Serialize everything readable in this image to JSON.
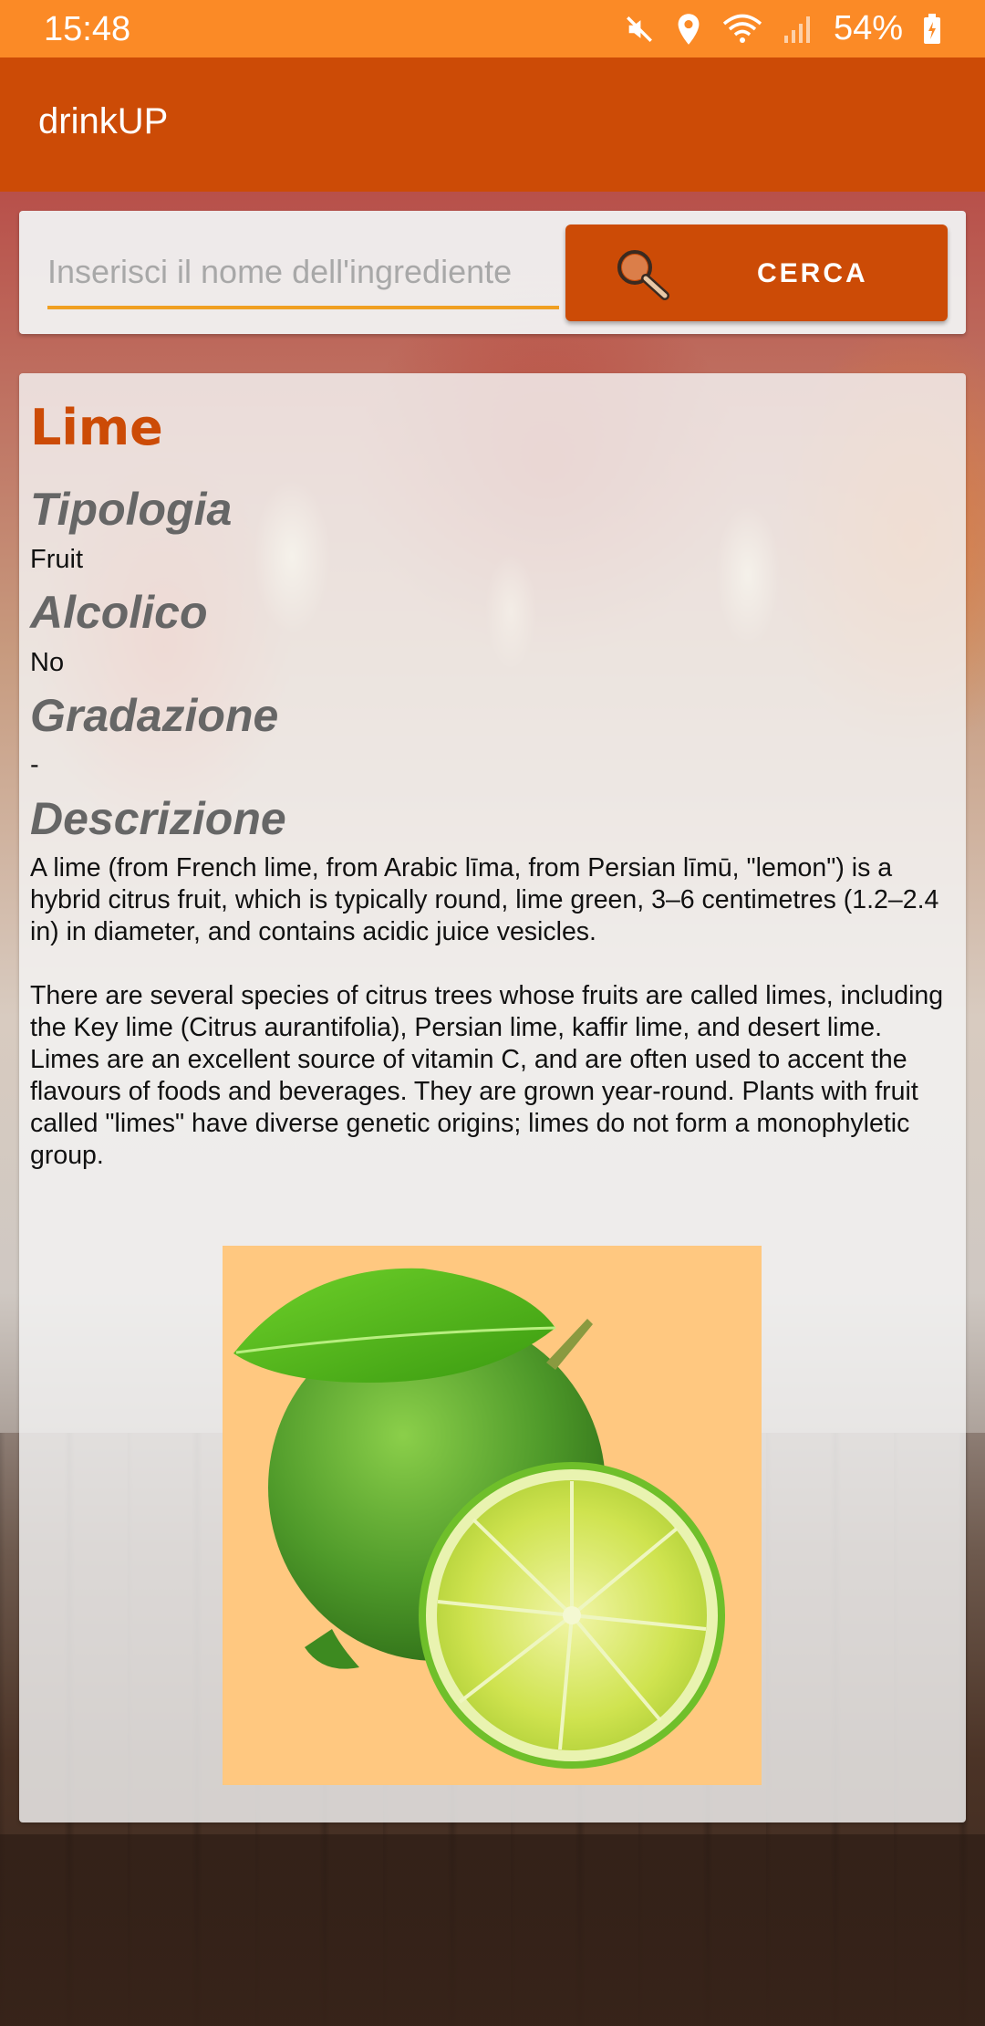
{
  "status_bar": {
    "time": "15:48",
    "battery": "54%",
    "icons": [
      "mute-icon",
      "location-icon",
      "wifi-icon",
      "signal-icon",
      "battery-icon"
    ]
  },
  "app_bar": {
    "title": "drinkUP"
  },
  "search": {
    "placeholder": "Inserisci il nome dell'ingrediente",
    "value": "",
    "button_label": "CERCA",
    "button_icon": "search-icon"
  },
  "ingredient": {
    "name": "Lime",
    "type_label": "Tipologia",
    "type_value": "Fruit",
    "alcoholic_label": "Alcolico",
    "alcoholic_value": "No",
    "abv_label": "Gradazione",
    "abv_value": "-",
    "description_label": "Descrizione",
    "description": "A lime (from French lime, from Arabic līma, from Persian līmū, \"lemon\") is a hybrid citrus fruit, which is typically round, lime green, 3–6 centimetres (1.2–2.4 in) in diameter, and contains acidic juice vesicles.\n\nThere are several species of citrus trees whose fruits are called limes, including the Key lime (Citrus aurantifolia), Persian lime, kaffir lime, and desert lime. Limes are an excellent source of vitamin C, and are often used to accent the flavours of foods and beverages. They are grown year-round. Plants with fruit called \"limes\" have diverse genetic origins; limes do not form a monophyletic group."
  },
  "colors": {
    "status_bar": "#fb8a26",
    "app_bar": "#cc4b06",
    "accent": "#cc4b06",
    "input_underline": "#f0a022",
    "image_background": "#ffc880"
  }
}
